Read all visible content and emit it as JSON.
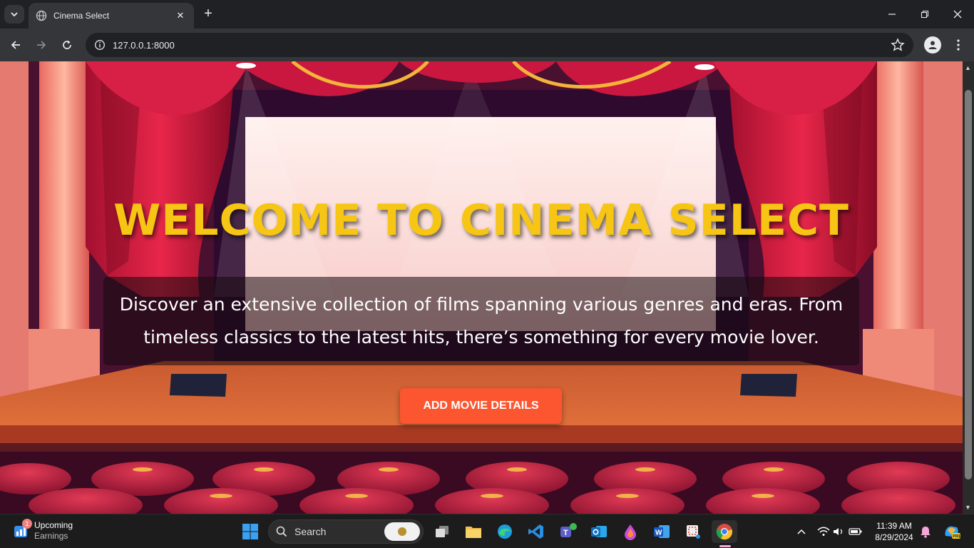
{
  "browser": {
    "tab_title": "Cinema Select",
    "url": "127.0.0.1:8000"
  },
  "page": {
    "title": "WELCOME TO CINEMA SELECT",
    "description": "Discover an extensive collection of films spanning various genres and eras. From timeless classics to the latest hits, there’s something for every movie lover.",
    "button_label": "ADD MOVIE DETAILS",
    "colors": {
      "title": "#f7c514",
      "button": "#fb5630"
    }
  },
  "taskbar": {
    "widget_title": "Upcoming",
    "widget_subtitle": "Earnings",
    "widget_badge": "1",
    "search_label": "Search",
    "time": "11:39 AM",
    "date": "8/29/2024"
  }
}
